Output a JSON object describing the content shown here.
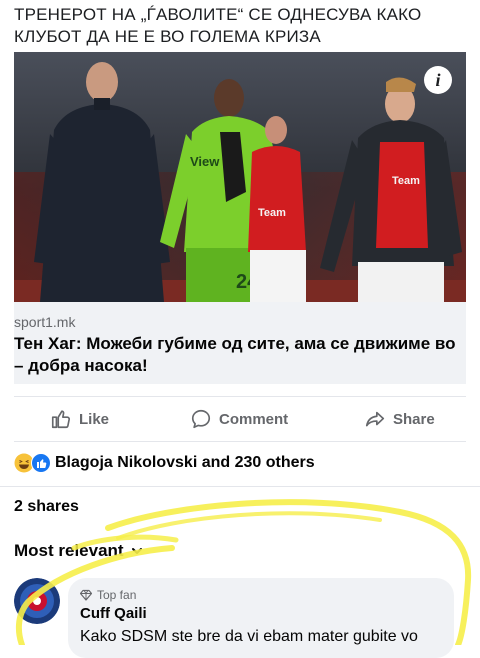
{
  "post": {
    "text": "ТРЕНЕРОТ НА „ЃАВОЛИТЕ“ СЕ ОДНЕСУВА КАКО КЛУБОТ ДА НЕ Е ВО ГОЛЕМА КРИЗА",
    "photo": {
      "info_icon": "info-icon",
      "jersey_text_left": "Team",
      "jersey_text_right": "Team",
      "keeper_jersey_text": "View",
      "keeper_number": "24"
    }
  },
  "link": {
    "domain": "sport1.mk",
    "title": "Тен Хаг: Можеби губиме од сите, ама се движиме во – добра насока!"
  },
  "actions": {
    "like": "Like",
    "comment": "Comment",
    "share": "Share"
  },
  "reactions": {
    "text": "Blagoja Nikolovski and 230 others",
    "icons": [
      "haha-icon",
      "like-icon"
    ]
  },
  "shares": "2 shares",
  "comments": {
    "sort_label": "Most relevant",
    "items": [
      {
        "badge": "Top fan",
        "name": "Cuff Qaili",
        "text": "Kako SDSM ste bre da vi ebam mater gubite vo"
      }
    ]
  },
  "colors": {
    "text_secondary": "#65676b",
    "card_bg": "#f0f2f5",
    "accent_blue": "#1877f2",
    "highlighter_yellow": "#f6ee4a"
  }
}
